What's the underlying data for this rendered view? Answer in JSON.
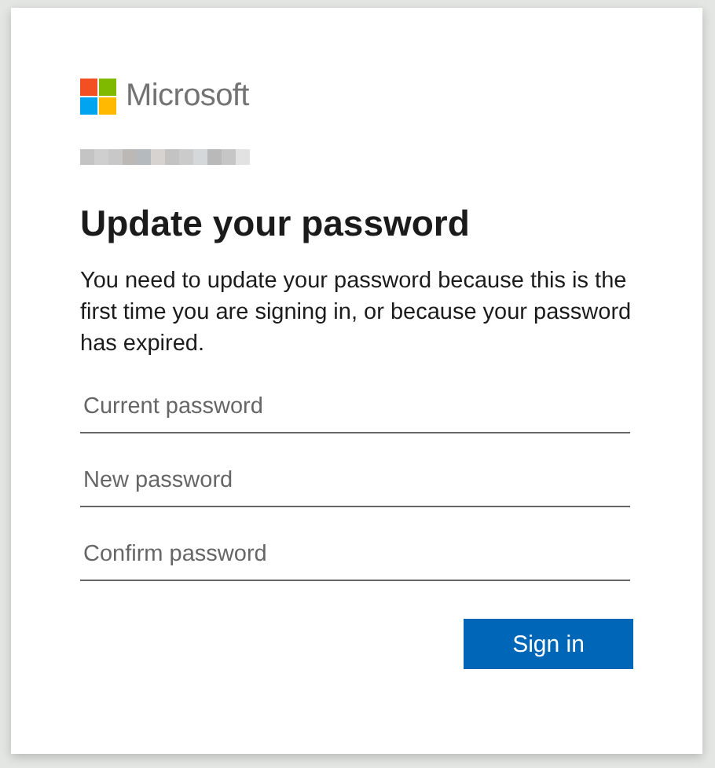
{
  "brand": {
    "name": "Microsoft"
  },
  "title": "Update your password",
  "message": "You need to update your password because this is the first time you are signing in, or because your password has expired.",
  "fields": [
    {
      "placeholder": "Current password"
    },
    {
      "placeholder": "New password"
    },
    {
      "placeholder": "Confirm password"
    }
  ],
  "buttons": [
    "Sign in"
  ]
}
